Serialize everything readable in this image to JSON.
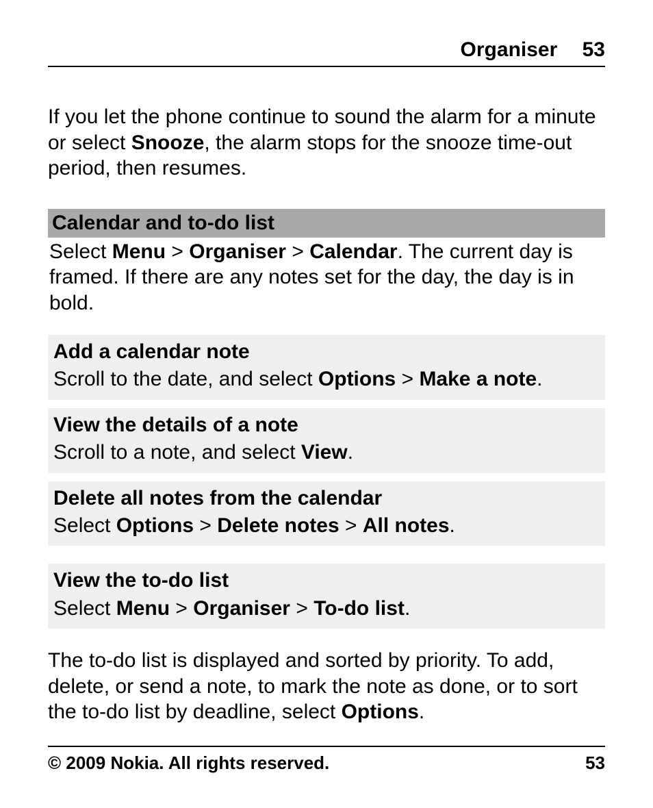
{
  "header": {
    "title": "Organiser",
    "page": "53"
  },
  "intro": {
    "t1": "If you let the phone continue to sound the alarm for a minute or select ",
    "b1": "Snooze",
    "t2": ", the alarm stops for the snooze time-out period, then resumes."
  },
  "section": {
    "heading": "Calendar and to-do list",
    "body_t1": "Select ",
    "body_b1": "Menu",
    "body_t2": " > ",
    "body_b2": "Organiser",
    "body_t3": " > ",
    "body_b3": "Calendar",
    "body_t4": ". The current day is framed. If there are any notes set for the day, the day is in bold."
  },
  "sub1": {
    "title": "Add a calendar note",
    "t1": "Scroll to the date, and select ",
    "b1": "Options",
    "t2": " > ",
    "b2": "Make a note",
    "t3": "."
  },
  "sub2": {
    "title": "View the details of a note",
    "t1": "Scroll to a note, and select ",
    "b1": "View",
    "t2": "."
  },
  "sub3": {
    "title": "Delete all notes from the calendar",
    "t1": "Select ",
    "b1": "Options",
    "t2": " > ",
    "b2": "Delete notes",
    "t3": " > ",
    "b3": "All notes",
    "t4": "."
  },
  "sub4": {
    "title": "View the to-do list",
    "t1": "Select ",
    "b1": "Menu",
    "t2": " > ",
    "b2": "Organiser",
    "t3": " > ",
    "b3": "To-do list",
    "t4": "."
  },
  "outro": {
    "t1": "The to-do list is displayed and sorted by priority. To add, delete, or send a note, to mark the note as done, or to sort the to-do list by deadline, select ",
    "b1": "Options",
    "t2": "."
  },
  "footer": {
    "copyright": "© 2009 Nokia. All rights reserved.",
    "page": "53"
  }
}
